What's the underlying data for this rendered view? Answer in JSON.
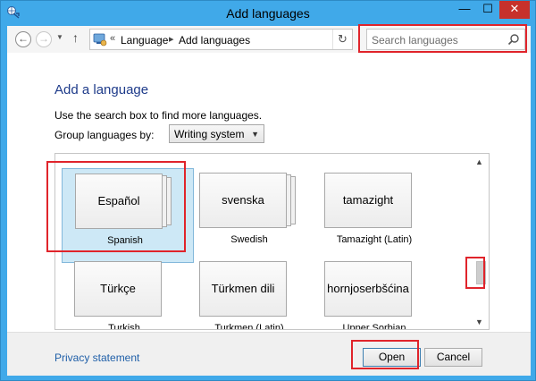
{
  "window": {
    "title": "Add languages",
    "minimize_glyph": "—",
    "maximize_glyph": "☐",
    "close_glyph": "✕"
  },
  "nav": {
    "back_glyph": "←",
    "forward_glyph": "→",
    "dropdown_glyph": "▼",
    "up_glyph": "↑",
    "breadcrumb_overflow": "«",
    "breadcrumbs": [
      "Language",
      "Add languages"
    ],
    "crumb_separator": "▸",
    "refresh_glyph": "↻"
  },
  "search": {
    "placeholder": "Search languages",
    "value": ""
  },
  "main": {
    "heading": "Add a language",
    "description": "Use the search box to find more languages.",
    "group_label": "Group languages by:",
    "group_value": "Writing system",
    "languages": [
      {
        "native": "Español",
        "english": "Spanish",
        "selected": true
      },
      {
        "native": "svenska",
        "english": "Swedish",
        "selected": false
      },
      {
        "native": "tamazight",
        "english": "Tamazight (Latin)",
        "selected": false
      },
      {
        "native": "Türkçe",
        "english": "Turkish",
        "selected": false
      },
      {
        "native": "Türkmen dili",
        "english": "Turkmen (Latin)",
        "selected": false
      },
      {
        "native": "hornjoserbšćina",
        "english": "Upper Sorbian",
        "selected": false
      }
    ],
    "scroll_up_glyph": "▲",
    "scroll_down_glyph": "▼"
  },
  "footer": {
    "privacy_link": "Privacy statement",
    "open_label": "Open",
    "cancel_label": "Cancel"
  },
  "colors": {
    "titlebar": "#40a9e9",
    "close": "#c7312b",
    "heading": "#1e3b8a",
    "link": "#1f5fa8",
    "selection": "#cde8f6",
    "highlight": "#e0242b"
  },
  "icons": {
    "app": "language-globe-icon",
    "search": "search-icon",
    "refresh": "refresh-icon"
  }
}
